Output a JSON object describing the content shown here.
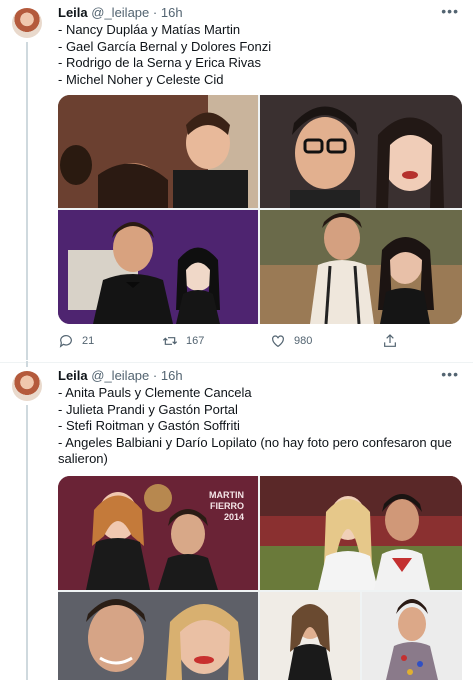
{
  "tweets": [
    {
      "user": {
        "name": "Leila",
        "handle": "@_leilape",
        "time": "16h"
      },
      "more_icon": "more-horizontal-icon",
      "lines": [
        "- Nancy Dupláa y Matías Martin",
        "- Gael García Bernal y Dolores Fonzi",
        "- Rodrigo de la Serna y Erica Rivas",
        "- Michel Noher y Celeste Cid"
      ],
      "photos": [
        "photo-couple-1",
        "photo-couple-2",
        "photo-couple-3",
        "photo-couple-4"
      ],
      "actions": {
        "replies": "21",
        "retweets": "167",
        "likes": "980"
      }
    },
    {
      "user": {
        "name": "Leila",
        "handle": "@_leilape",
        "time": "16h"
      },
      "more_icon": "more-horizontal-icon",
      "lines": [
        "- Anita Pauls y Clemente Cancela",
        "- Julieta Prandi y Gastón Portal",
        "- Stefi Roitman y Gastón Soffriti",
        "- Angeles Balbiani y Darío Lopilato (no hay foto pero confesaron que salieron)"
      ],
      "photos": [
        "photo-couple-5",
        "photo-couple-6",
        "photo-couple-7",
        "photo-couple-8",
        "photo-couple-9"
      ],
      "photo_text": {
        "event_sign": "MARTIN FIERRO 2014"
      }
    }
  ],
  "colors": {
    "text": "#0f1419",
    "muted": "#536471",
    "thread_line": "#cfd9de"
  }
}
